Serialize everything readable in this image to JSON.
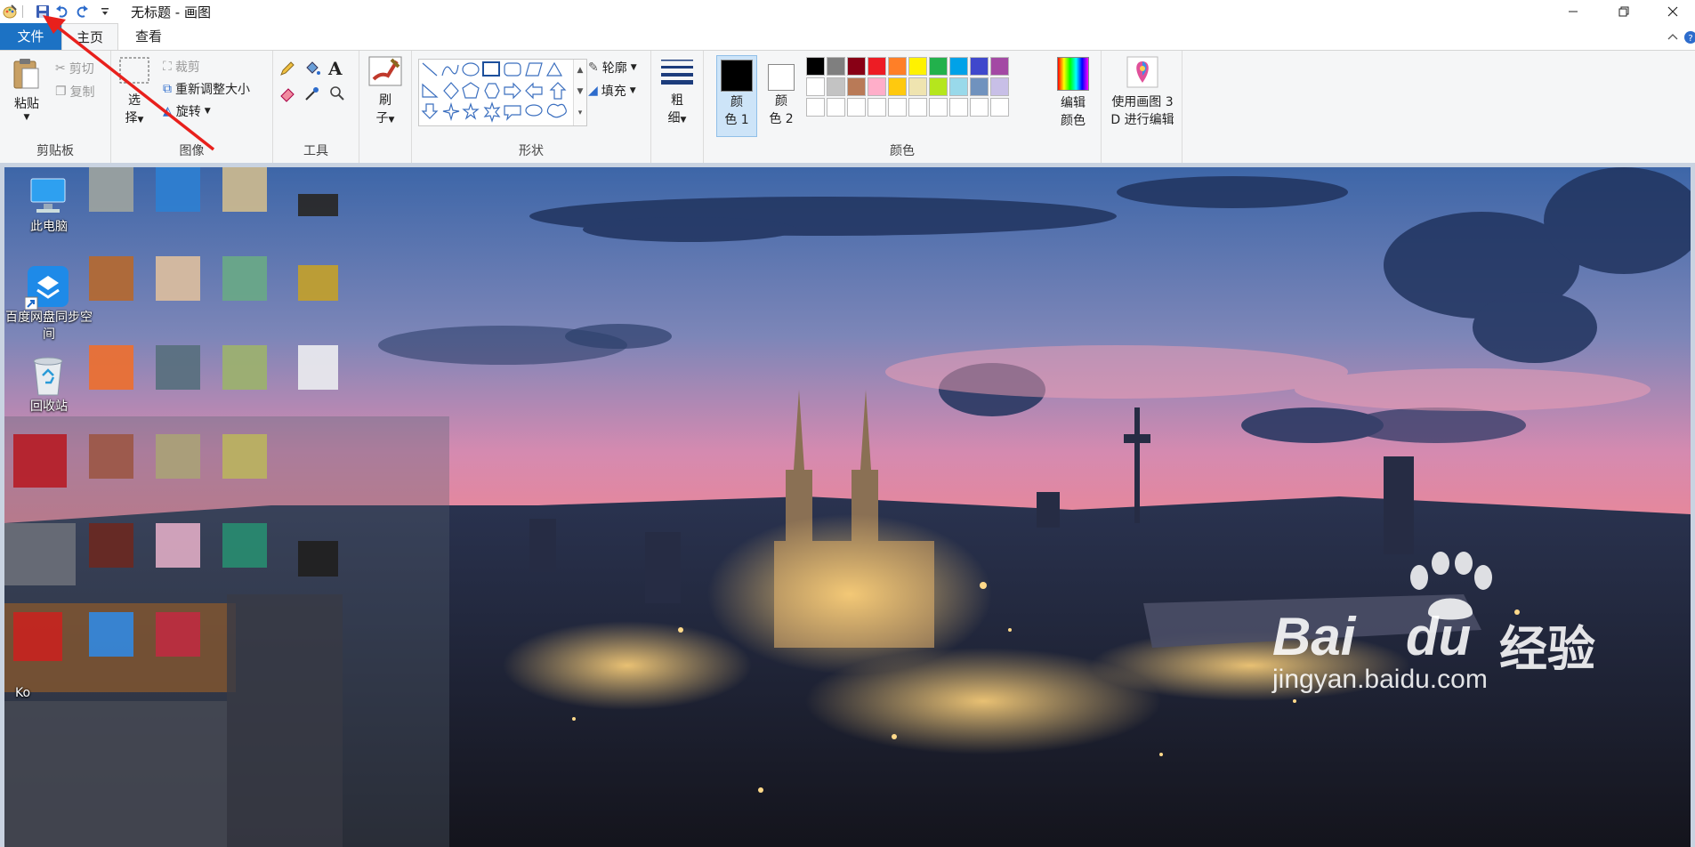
{
  "window": {
    "title": "无标题 - 画图"
  },
  "tabs": [
    {
      "label": "文件"
    },
    {
      "label": "主页"
    },
    {
      "label": "查看"
    }
  ],
  "clipboard": {
    "paste": "粘贴",
    "cut": "剪切",
    "copy": "复制",
    "group": "剪贴板"
  },
  "image": {
    "select_line1": "选",
    "select_line2": "择",
    "crop": "裁剪",
    "resize": "重新调整大小",
    "rotate": "旋转",
    "group": "图像"
  },
  "tools": {
    "group": "工具",
    "text_glyph": "A"
  },
  "brushes": {
    "line1": "刷",
    "line2": "子"
  },
  "shapes": {
    "outline": "轮廓",
    "fill": "填充",
    "group": "形状"
  },
  "size": {
    "line1": "粗",
    "line2": "细"
  },
  "colors": {
    "color1_line1": "颜",
    "color1_line2": "色 1",
    "color2_line1": "颜",
    "color2_line2": "色 2",
    "edit_line1": "编辑",
    "edit_line2": "颜色",
    "group": "颜色",
    "color1_value": "#000000",
    "color2_value": "#ffffff",
    "palette_row1": [
      "#000000",
      "#7f7f7f",
      "#880015",
      "#ed1c24",
      "#ff7f27",
      "#fff200",
      "#22b14c",
      "#00a2e8",
      "#3f48cc",
      "#a349a4"
    ],
    "palette_row2": [
      "#ffffff",
      "#c3c3c3",
      "#b97a57",
      "#ffaec9",
      "#ffc90e",
      "#efe4b0",
      "#b5e61d",
      "#99d9ea",
      "#7092be",
      "#c8bfe7"
    ]
  },
  "paint3d": {
    "line1": "使用画图 3",
    "line2": "D 进行编辑"
  },
  "desktop": {
    "icons": [
      {
        "label": "此电脑"
      },
      {
        "label": "百度网盘同步空间"
      },
      {
        "label": "回收站"
      }
    ],
    "partial_label": "Ko"
  },
  "watermark": {
    "brand_left": "Bai",
    "brand_right": "du",
    "cn": "经验",
    "url": "jingyan.baidu.com"
  }
}
